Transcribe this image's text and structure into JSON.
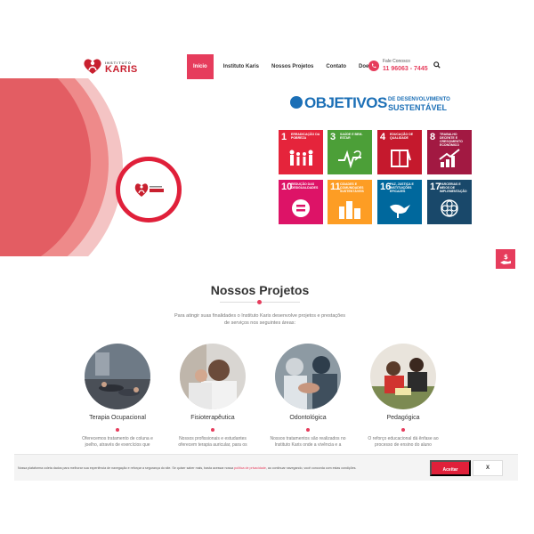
{
  "brand": {
    "logo_small": "INSTITUTO",
    "logo_big": "KARIS",
    "accent": "#e63c5c"
  },
  "nav": {
    "items": [
      {
        "label": "Início",
        "active": true
      },
      {
        "label": "Instituto Karis"
      },
      {
        "label": "Nossos Projetos"
      },
      {
        "label": "Contato"
      },
      {
        "label": "Doe Já!"
      }
    ]
  },
  "contact": {
    "label": "Fale Conosco",
    "phone": "11 96063 - 7445"
  },
  "ods": {
    "title": "OBJETIVOS",
    "subtitle_line1": "DE DESENVOLVIMENTO",
    "subtitle_line2": "SUSTENTÁVEL",
    "tiles": [
      {
        "num": "1",
        "title": "ERRADICAÇÃO DA POBREZA",
        "color": "#e5243b",
        "icon": "people-icon"
      },
      {
        "num": "3",
        "title": "SAÚDE E BEM-ESTAR",
        "color": "#4c9f38",
        "icon": "heartbeat-icon"
      },
      {
        "num": "4",
        "title": "EDUCAÇÃO DE QUALIDADE",
        "color": "#c5192d",
        "icon": "book-icon"
      },
      {
        "num": "8",
        "title": "TRABALHO DECENTE E CRESCIMENTO ECONÔMICO",
        "color": "#a21942",
        "icon": "growth-chart-icon"
      },
      {
        "num": "10",
        "title": "REDUÇÃO DAS DESIGUALDADES",
        "color": "#dd1367",
        "icon": "equality-icon"
      },
      {
        "num": "11",
        "title": "CIDADES E COMUNIDADES SUSTENTÁVEIS",
        "color": "#fd9d24",
        "icon": "city-icon"
      },
      {
        "num": "16",
        "title": "PAZ, JUSTIÇA E INSTITUIÇÕES EFICAZES",
        "color": "#00689d",
        "icon": "dove-icon"
      },
      {
        "num": "17",
        "title": "PARCERIAS E MEIOS DE IMPLEMENTAÇÃO",
        "color": "#19486a",
        "icon": "partnership-icon"
      }
    ]
  },
  "projects": {
    "title": "Nossos Projetos",
    "intro": "Para atingir suas finalidades o Instituto Karis desenvolve projetos e prestações de serviços nos seguintes áreas:",
    "cards": [
      {
        "title": "Terapia Ocupacional",
        "text": "Oferecemos tratamento de coluna e joelho, através de exercícios que"
      },
      {
        "title": "Fisioterapêutica",
        "text": "Nossos profissionais e estudantes oferecem terapia auricular, para os"
      },
      {
        "title": "Odontológica",
        "text": "Nossos tratamentos são realizados no Instituto Karis onde a vivência e a"
      },
      {
        "title": "Pedagógica",
        "text": "O reforço educacional dá ênfase ao processo de ensino do aluno"
      }
    ]
  },
  "cookie": {
    "text_before": "Nossa plataforma coleta dados para melhorar sua experiência de navegação e reforçar a segurança do site. Se quiser saber mais, basta acessar nossa ",
    "link": "política de privacidade",
    "text_after": ", ao continuar navegando, você concorda com estas condições.",
    "accept": "Aceitar",
    "close": "X"
  }
}
